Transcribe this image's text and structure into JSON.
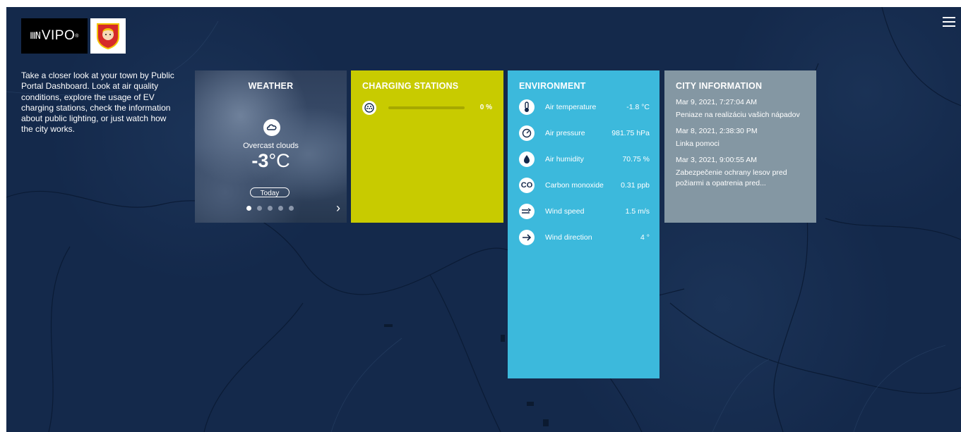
{
  "brand": {
    "name": "VIPO",
    "mark": "ⅢN",
    "trademark": "®"
  },
  "intro_text": "Take a closer look at your town by Public Portal Dashboard. Look at air quality conditions, explore the usage of EV charging stations, check the information about public lighting, or just watch how the city works.",
  "weather": {
    "title": "WEATHER",
    "description": "Overcast clouds",
    "temperature": "-3",
    "unit": "°C",
    "day_button": "Today",
    "pages": 5,
    "active_page": 1
  },
  "charging": {
    "title": "CHARGING STATIONS",
    "usage": "0 %",
    "usage_fraction": 0.0
  },
  "environment": {
    "title": "ENVIRONMENT",
    "rows": [
      {
        "icon": "thermometer-icon",
        "label": "Air temperature",
        "value": "-1.8 °C"
      },
      {
        "icon": "gauge-icon",
        "label": "Air pressure",
        "value": "981.75 hPa"
      },
      {
        "icon": "droplet-icon",
        "label": "Air humidity",
        "value": "70.75 %"
      },
      {
        "icon": "co-icon",
        "label": "Carbon monoxide",
        "value": "0.31 ppb",
        "icon_text": "CO"
      },
      {
        "icon": "wind-icon",
        "label": "Wind speed",
        "value": "1.5 m/s"
      },
      {
        "icon": "arrow-right-icon",
        "label": "Wind direction",
        "value": "4 °"
      }
    ]
  },
  "city": {
    "title": "CITY INFORMATION",
    "news": [
      {
        "date": "Mar 9, 2021, 7:27:04 AM",
        "title": "Peniaze na realizáciu vašich nápadov"
      },
      {
        "date": "Mar 8, 2021, 2:38:30 PM",
        "title": "Linka pomoci"
      },
      {
        "date": "Mar 3, 2021, 9:00:55 AM",
        "title": "Zabezpečenie ochrany lesov pred požiarmi a opatrenia pred..."
      }
    ]
  },
  "colors": {
    "map": "#14294b",
    "charging": "#c8cb00",
    "environment": "#3cb9dc",
    "city": "#8497a3"
  }
}
